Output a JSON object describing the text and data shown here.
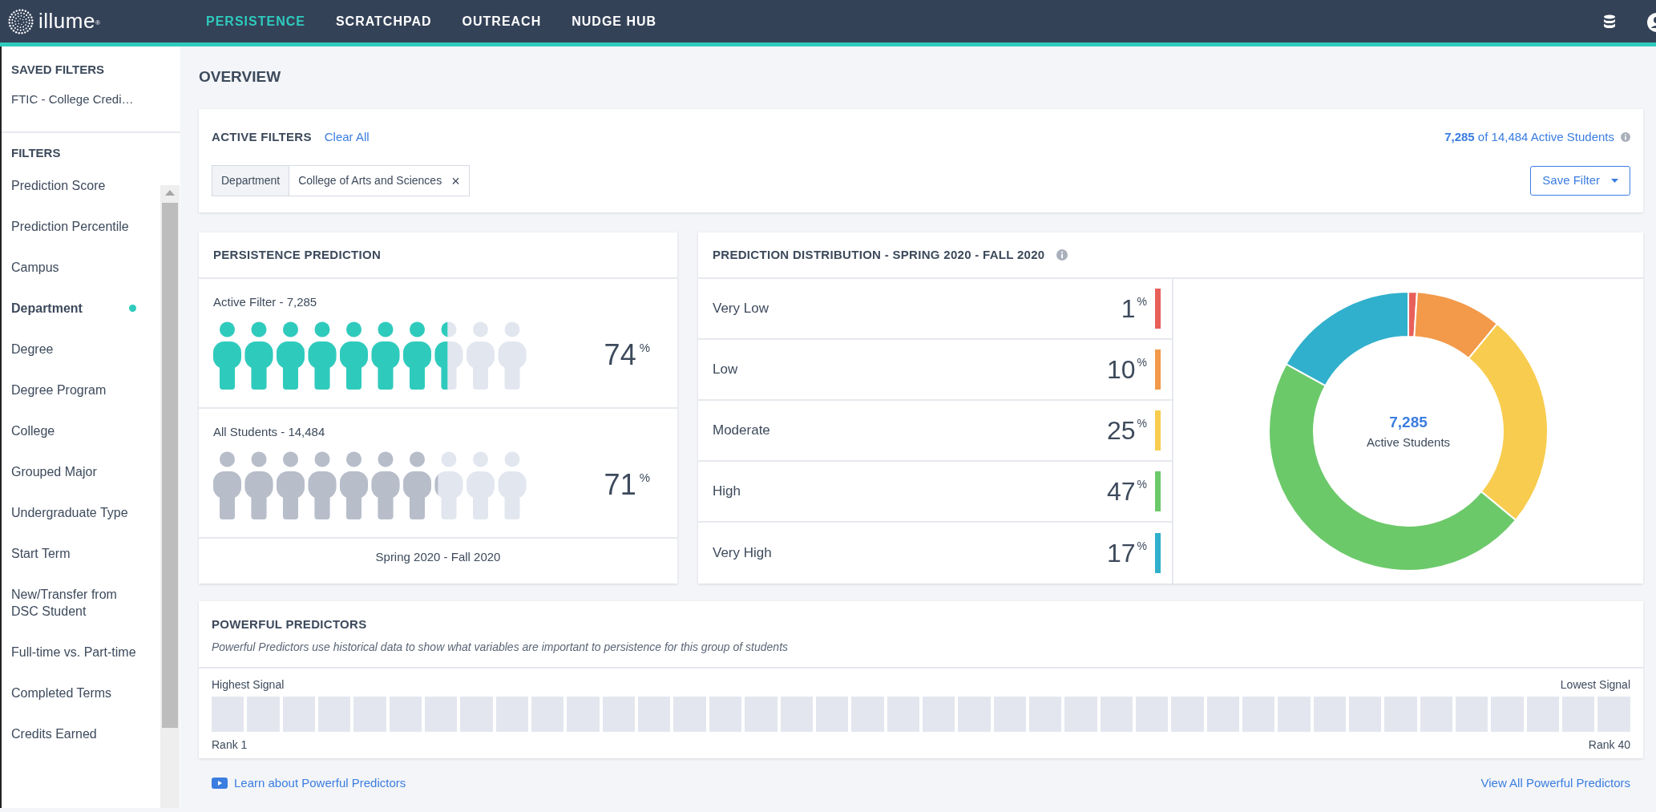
{
  "nav": {
    "logo": "illume$^{®}$",
    "items": [
      {
        "label": "PERSISTENCE",
        "selected": true
      },
      {
        "label": "SCRATCHPAD",
        "selected": false
      },
      {
        "label": "OUTREACH",
        "selected": false
      },
      {
        "label": "NUDGE HUB",
        "selected": false
      }
    ]
  },
  "sidebar": {
    "saved_title": "SAVED FILTERS",
    "saved": [
      "FTIC - College Credi…"
    ],
    "filters_title": "FILTERS",
    "filters": [
      {
        "label": "Prediction Score",
        "active": false
      },
      {
        "label": "Prediction Percentile",
        "active": false
      },
      {
        "label": "Campus",
        "active": false
      },
      {
        "label": "Department",
        "active": true
      },
      {
        "label": "Degree",
        "active": false
      },
      {
        "label": "Degree Program",
        "active": false
      },
      {
        "label": "College",
        "active": false
      },
      {
        "label": "Grouped Major",
        "active": false
      },
      {
        "label": "Undergraduate Type",
        "active": false
      },
      {
        "label": "Start Term",
        "active": false
      },
      {
        "label": "New/Transfer from DSC Student",
        "active": false
      },
      {
        "label": "Full-time vs. Part-time",
        "active": false
      },
      {
        "label": "Completed Terms",
        "active": false
      },
      {
        "label": "Credits Earned",
        "active": false
      }
    ]
  },
  "overview": {
    "title": "OVERVIEW"
  },
  "active_filters": {
    "title": "ACTIVE FILTERS",
    "clear": "Clear All",
    "count": "7,285",
    "count_rest": "of 14,484 Active Students",
    "chips": [
      {
        "field": "Department",
        "value": "College of Arts and Sciences",
        "remove": "×"
      }
    ],
    "save_button": "Save Filter"
  },
  "persistence": {
    "title": "PERSISTENCE PREDICTION",
    "groups": [
      {
        "label": "Active Filter - 7,285",
        "kind": "filter",
        "level": 0.74,
        "value": "74",
        "unit": "%"
      },
      {
        "label": "All Students - 14,484",
        "kind": "all",
        "level": 0.71,
        "value": "71",
        "unit": "%"
      }
    ],
    "period": "Spring 2020 - Fall 2020"
  },
  "distribution": {
    "title": "PREDICTION DISTRIBUTION - SPRING 2020 - FALL 2020",
    "levels": [
      {
        "value": "1",
        "unit": "%",
        "color": "#e8605a"
      },
      {
        "value": "10",
        "unit": "%",
        "color": "#f2994a"
      },
      {
        "value": "25",
        "unit": "%",
        "color": "#f8cc4e"
      },
      {
        "value": "47",
        "unit": "%",
        "color": "#6cc96a"
      },
      {
        "value": "17",
        "unit": "%",
        "color": "#30b0cc"
      }
    ],
    "center_value": "7,285",
    "center_label": "Active Students",
    "chart_data": {
      "type": "donut",
      "categories": [
        "Very Low",
        "Low",
        "Moderate",
        "High",
        "Very High"
      ],
      "values": [
        1,
        10,
        25,
        47,
        17
      ]
    }
  },
  "predictors": {
    "title": "POWERFUL PREDICTORS",
    "description": "Powerful Predictors use historical data to show what variables are important to persistence for this group of students",
    "left_label": "Highest Signal",
    "right_label": "Lowest Signal",
    "first_rank": "Rank 1",
    "last_rank": "Rank 40"
  },
  "footer": {
    "learn_link": "Learn about Powerful Predictors",
    "view_all": "View All Powerful Predictors"
  }
}
